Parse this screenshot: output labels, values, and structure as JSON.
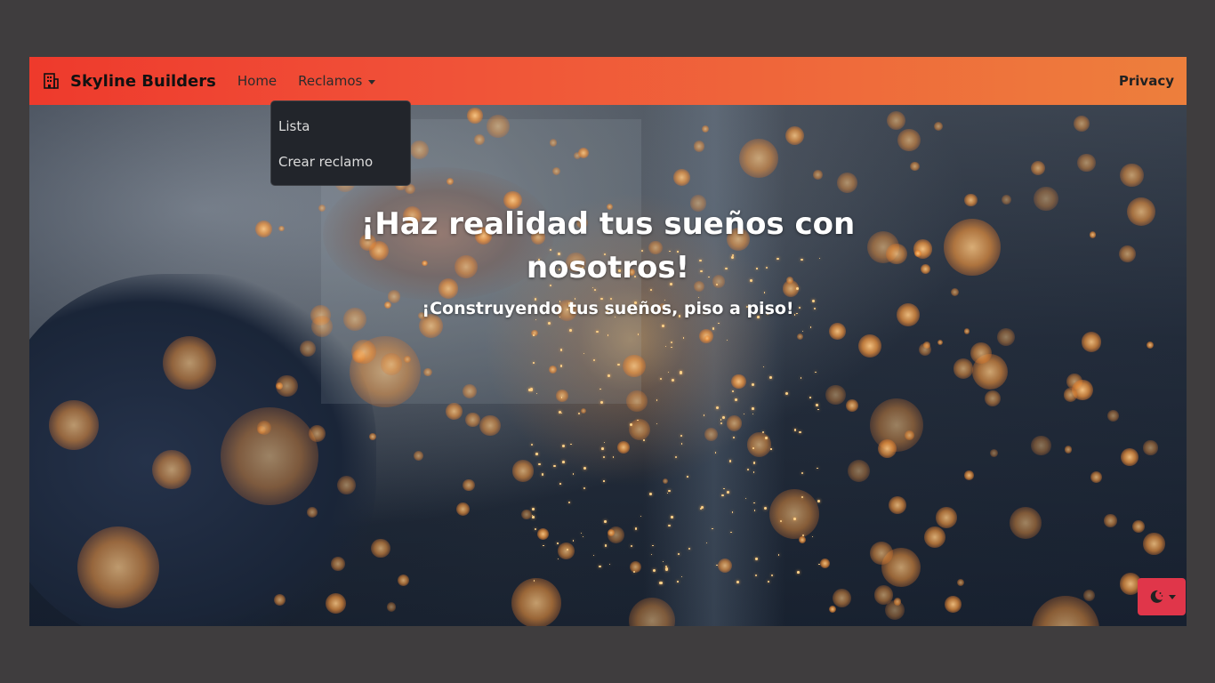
{
  "navbar": {
    "brand": "Skyline Builders",
    "brand_icon": "building-icon",
    "home_label": "Home",
    "reclamos_label": "Reclamos",
    "privacy_label": "Privacy",
    "gradient_start": "#ee3a2c",
    "gradient_end": "#ed7f3c"
  },
  "dropdown": {
    "items": [
      {
        "label": "Lista"
      },
      {
        "label": "Crear reclamo"
      }
    ]
  },
  "hero": {
    "title": "¡Haz realidad tus sueños con nosotros!",
    "subtitle": "¡Construyendo tus sueños, piso a piso!"
  },
  "theme_toggle": {
    "icon": "moon-stars-icon",
    "color": "#e0364a"
  }
}
